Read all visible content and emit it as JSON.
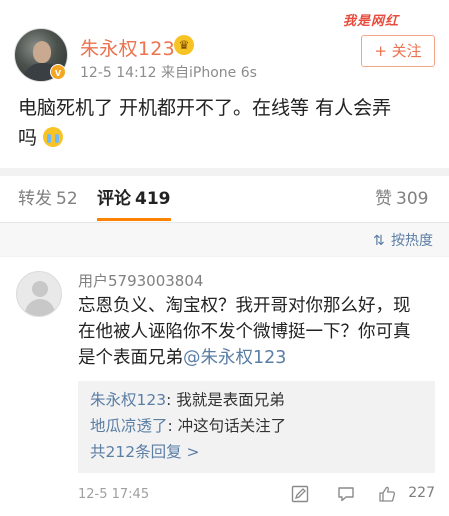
{
  "watermark": "我是网红",
  "post": {
    "username": "朱永权123",
    "meta": "12-5 14:12  来自iPhone 6s",
    "follow_label": "+ 关注",
    "text": "电脑死机了 开机都开不了。在线等 有人会弄吗",
    "text_line1": "电脑死机了 开机都开不了。在线等 有人会弄",
    "text_line2": "吗"
  },
  "tabs": [
    {
      "label": "转发",
      "count": "52"
    },
    {
      "label": "评论",
      "count": "419"
    },
    {
      "label": "赞",
      "count": "309"
    }
  ],
  "sort": {
    "label": "按热度"
  },
  "comment": {
    "username": "用户5793003804",
    "text_line1": "忘恩负义、淘宝权？我开哥对你那么好，现",
    "text_line2": "在他被人诬陷你不发个微博挺一下？你可真",
    "text_line3": "是个表面兄弟",
    "mention": "@朱永权123",
    "replies": [
      {
        "name": "朱永权123",
        "text": ": 我就是表面兄弟"
      },
      {
        "name": "地瓜凉透了",
        "text": ": 冲这句话关注了"
      }
    ],
    "more_replies": "共212条回复 >",
    "time": "12-5 17:45",
    "likes": "227"
  },
  "colors": {
    "accent": "#eb7350",
    "link": "#5b7ea5",
    "tab_underline": "#ff8200"
  }
}
